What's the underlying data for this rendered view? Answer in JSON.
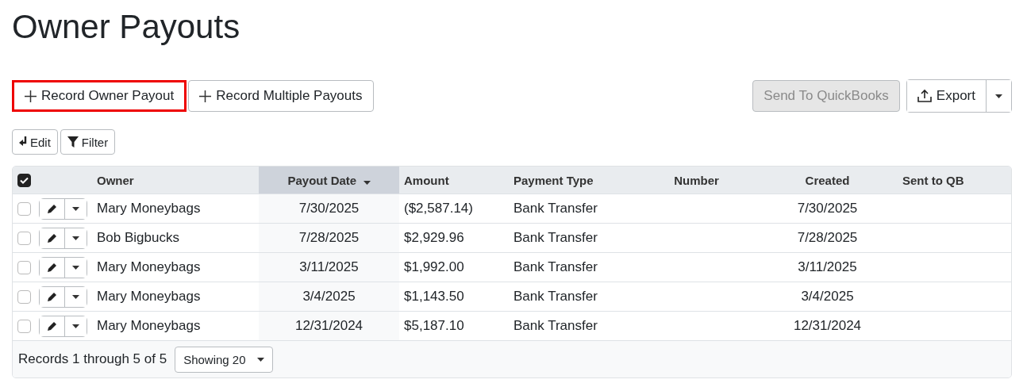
{
  "title": "Owner Payouts",
  "actions": [
    {
      "label": "Record Owner Payout",
      "highlighted": true
    },
    {
      "label": "Record Multiple Payouts",
      "highlighted": false
    }
  ],
  "right_actions": [
    {
      "label": "Send To QuickBooks",
      "disabled": true,
      "kind": "plain"
    },
    {
      "label": "Export",
      "disabled": false,
      "kind": "split"
    }
  ],
  "tools": [
    {
      "label": "Edit"
    },
    {
      "label": "Filter"
    }
  ],
  "table": {
    "select_all_checked": true,
    "columns": [
      {
        "label": "Owner",
        "sorted": false
      },
      {
        "label": "Payout Date",
        "sorted": true
      },
      {
        "label": "Amount",
        "sorted": false
      },
      {
        "label": "Payment Type",
        "sorted": false
      },
      {
        "label": "Number",
        "sorted": false
      },
      {
        "label": "Created",
        "sorted": false
      },
      {
        "label": "Sent to QB",
        "sorted": false
      }
    ],
    "rows": [
      {
        "checked": false,
        "cells": [
          "Mary Moneybags",
          "7/30/2025",
          "($2,587.14)",
          "Bank Transfer",
          "",
          "7/30/2025",
          ""
        ]
      },
      {
        "checked": false,
        "cells": [
          "Bob Bigbucks",
          "7/28/2025",
          "$2,929.96",
          "Bank Transfer",
          "",
          "7/28/2025",
          ""
        ]
      },
      {
        "checked": false,
        "cells": [
          "Mary Moneybags",
          "3/11/2025",
          "$1,992.00",
          "Bank Transfer",
          "",
          "3/11/2025",
          ""
        ]
      },
      {
        "checked": false,
        "cells": [
          "Mary Moneybags",
          "3/4/2025",
          "$1,143.50",
          "Bank Transfer",
          "",
          "3/4/2025",
          ""
        ]
      },
      {
        "checked": false,
        "cells": [
          "Mary Moneybags",
          "12/31/2024",
          "$5,187.10",
          "Bank Transfer",
          "",
          "12/31/2024",
          ""
        ]
      }
    ]
  },
  "footer": {
    "records": "Records 1 through 5 of 5",
    "page_size": "Showing 20"
  }
}
